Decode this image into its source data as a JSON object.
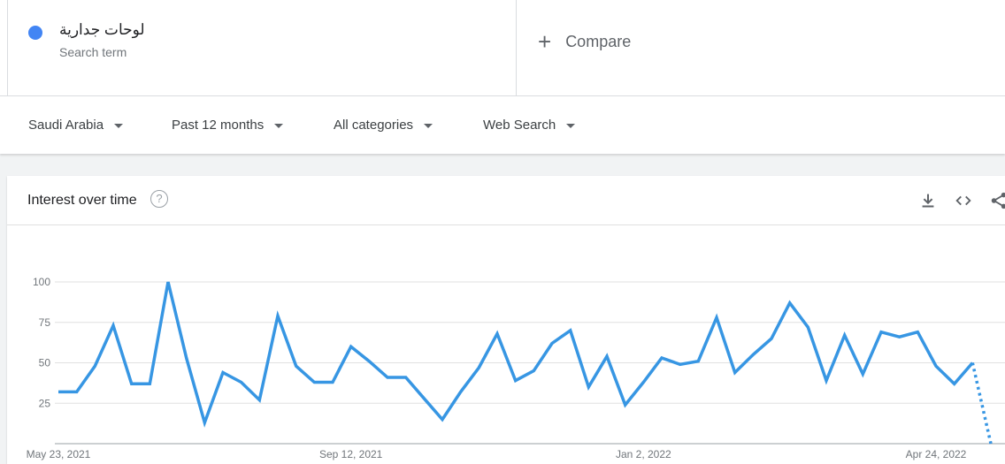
{
  "search_term": {
    "name": "لوحات جدارية",
    "subtitle": "Search term",
    "color": "#4285f4"
  },
  "compare": {
    "label": "Compare"
  },
  "filters": [
    {
      "label": "Saudi Arabia"
    },
    {
      "label": "Past 12 months"
    },
    {
      "label": "All categories"
    },
    {
      "label": "Web Search"
    }
  ],
  "card": {
    "title": "Interest over time",
    "help_icon": "?"
  },
  "icons": [
    "download-icon",
    "embed-code-icon",
    "share-icon"
  ],
  "chart_data": {
    "type": "line",
    "title": "",
    "xlabel": "",
    "ylabel": "",
    "ylim": [
      0,
      100
    ],
    "y_ticks": [
      25,
      50,
      75,
      100
    ],
    "x_tick_labels": [
      "May 23, 2021",
      "Sep 12, 2021",
      "Jan 2, 2022",
      "Apr 24, 2022"
    ],
    "x_tick_indices": [
      0,
      16,
      32,
      48
    ],
    "grid": true,
    "line_color": "#3796e3",
    "series": [
      {
        "values": [
          32,
          32,
          48,
          73,
          37,
          37,
          100,
          53,
          13,
          44,
          38,
          27,
          79,
          48,
          38,
          38,
          60,
          51,
          41,
          41,
          28,
          15,
          32,
          47,
          68,
          39,
          45,
          62,
          70,
          35,
          54,
          24,
          38,
          53,
          49,
          51,
          78,
          44,
          55,
          65,
          87,
          72,
          39,
          67,
          43,
          69,
          66,
          69,
          48,
          37,
          50,
          0
        ],
        "partial_from_index": 50
      }
    ]
  }
}
